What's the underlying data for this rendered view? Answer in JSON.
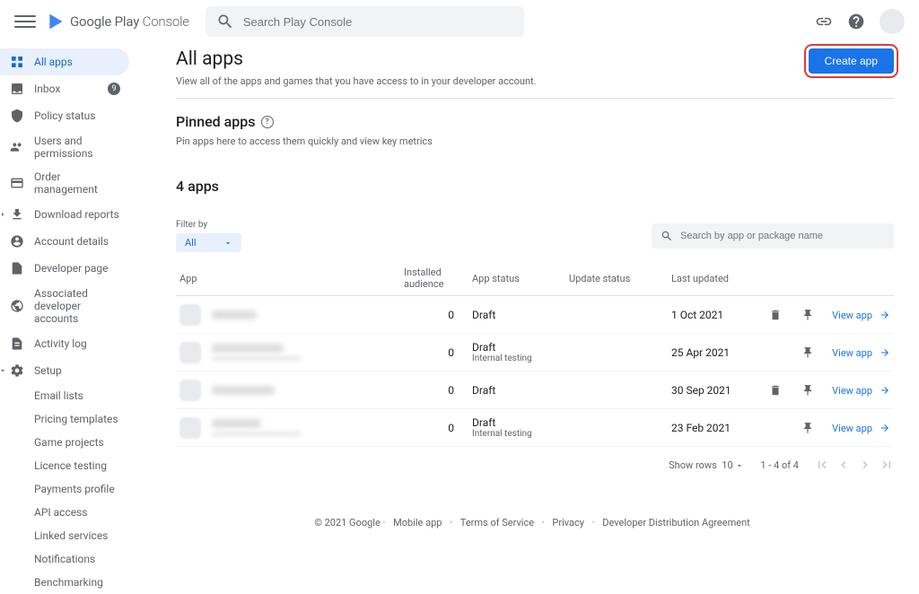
{
  "brand": {
    "name": "Google Play",
    "suffix": "Console"
  },
  "search": {
    "placeholder": "Search Play Console"
  },
  "sidebar": {
    "items": [
      {
        "icon": "apps",
        "label": "All apps",
        "active": true
      },
      {
        "icon": "inbox",
        "label": "Inbox",
        "badge": "9"
      },
      {
        "icon": "shield",
        "label": "Policy status"
      },
      {
        "icon": "people",
        "label": "Users and permissions"
      },
      {
        "icon": "card",
        "label": "Order management"
      },
      {
        "icon": "download",
        "label": "Download reports",
        "expandLeft": true
      },
      {
        "icon": "account",
        "label": "Account details"
      },
      {
        "icon": "page",
        "label": "Developer page"
      },
      {
        "icon": "globe",
        "label": "Associated developer accounts"
      },
      {
        "icon": "doc",
        "label": "Activity log"
      },
      {
        "icon": "gear",
        "label": "Setup",
        "expandLeft": true,
        "expandOpen": true
      }
    ],
    "setup_subs": [
      "Email lists",
      "Pricing templates",
      "Game projects",
      "Licence testing",
      "Payments profile",
      "API access",
      "Linked services",
      "Notifications",
      "Benchmarking"
    ]
  },
  "page": {
    "title": "All apps",
    "subtitle": "View all of the apps and games that you have access to in your developer account.",
    "create_btn": "Create app"
  },
  "pinned": {
    "title": "Pinned apps",
    "desc": "Pin apps here to access them quickly and view key metrics"
  },
  "apps": {
    "count_title": "4 apps",
    "filter_label": "Filter by",
    "filter_value": "All",
    "table_search_placeholder": "Search by app or package name",
    "columns": [
      "App",
      "Installed audience",
      "App status",
      "Update status",
      "Last updated"
    ],
    "rows": [
      {
        "name_w": 50,
        "sub": false,
        "aud": "0",
        "status": "Draft",
        "status_sub": "",
        "date": "1 Oct 2021",
        "trash": true,
        "view": "View app"
      },
      {
        "name_w": 80,
        "sub": true,
        "aud": "0",
        "status": "Draft",
        "status_sub": "Internal testing",
        "date": "25 Apr 2021",
        "trash": false,
        "view": "View app"
      },
      {
        "name_w": 70,
        "sub": false,
        "aud": "0",
        "status": "Draft",
        "status_sub": "",
        "date": "30 Sep 2021",
        "trash": true,
        "view": "View app"
      },
      {
        "name_w": 55,
        "sub": true,
        "aud": "0",
        "status": "Draft",
        "status_sub": "Internal testing",
        "date": "23 Feb 2021",
        "trash": false,
        "view": "View app"
      }
    ],
    "pagination": {
      "show_rows": "Show rows",
      "rows": "10",
      "range": "1 - 4 of 4"
    }
  },
  "footer": {
    "copyright": "© 2021 Google",
    "links": [
      "Mobile app",
      "Terms of Service",
      "Privacy",
      "Developer Distribution Agreement"
    ]
  }
}
